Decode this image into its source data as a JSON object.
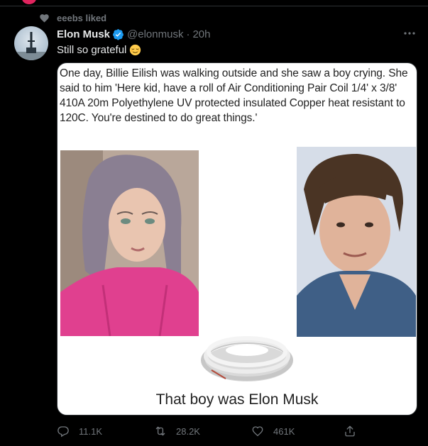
{
  "social_context": {
    "text": "eeebs liked"
  },
  "tweet": {
    "author_name": "Elon Musk",
    "handle": "@elonmusk",
    "time": "20h",
    "text": "Still so grateful",
    "media": {
      "meme_text": "One day, Billie Eilish was walking outside and she saw a boy crying. She said to him 'Here kid, have a roll of Air Conditioning Pair Coil 1/4' x 3/8' 410A 20m Polyethylene UV protected insulated Copper heat resistant to 120C. You're destined to do great things.'",
      "caption": "That boy was Elon Musk"
    },
    "actions": {
      "replies": "11.1K",
      "retweets": "28.2K",
      "likes": "461K"
    }
  },
  "colors": {
    "background": "#000000",
    "text_primary": "#e7e9ea",
    "text_secondary": "#71767b",
    "verified": "#1d9bf0",
    "border": "#2f3336"
  }
}
